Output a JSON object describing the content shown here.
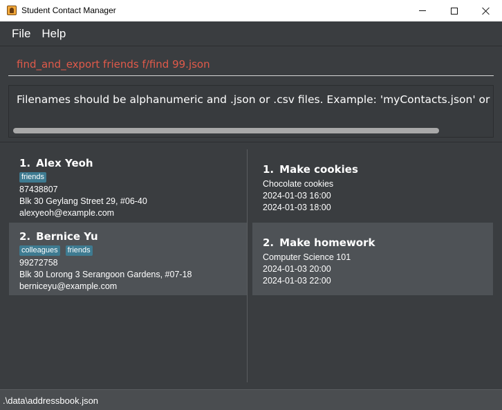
{
  "window": {
    "title": "Student Contact Manager"
  },
  "menu": {
    "file": "File",
    "help": "Help"
  },
  "command": {
    "value": "find_and_export friends f/find 99.json"
  },
  "result": {
    "message": "Filenames should be alphanumeric and .json or .csv files. Example: 'myContacts.json' or 'myContacts.csv'"
  },
  "persons": [
    {
      "index": "1.",
      "name": "Alex Yeoh",
      "tags": [
        "friends"
      ],
      "phone": "87438807",
      "address": "Blk 30 Geylang Street 29, #06-40",
      "email": "alexyeoh@example.com"
    },
    {
      "index": "2.",
      "name": "Bernice Yu",
      "tags": [
        "colleagues",
        "friends"
      ],
      "phone": "99272758",
      "address": "Blk 30 Lorong 3 Serangoon Gardens, #07-18",
      "email": "berniceyu@example.com"
    }
  ],
  "tasks": [
    {
      "index": "1.",
      "title": "Make cookies",
      "description": "Chocolate cookies",
      "start": "2024-01-03 16:00",
      "end": "2024-01-03 18:00"
    },
    {
      "index": "2.",
      "title": "Make homework",
      "description": "Computer Science 101",
      "start": "2024-01-03 20:00",
      "end": "2024-01-03 22:00"
    }
  ],
  "status": {
    "path": ".\\data\\addressbook.json"
  },
  "colors": {
    "background": "#3a3d40",
    "selected_card": "#4e5256",
    "tag": "#3e7b91",
    "command_text": "#e05a4a"
  }
}
